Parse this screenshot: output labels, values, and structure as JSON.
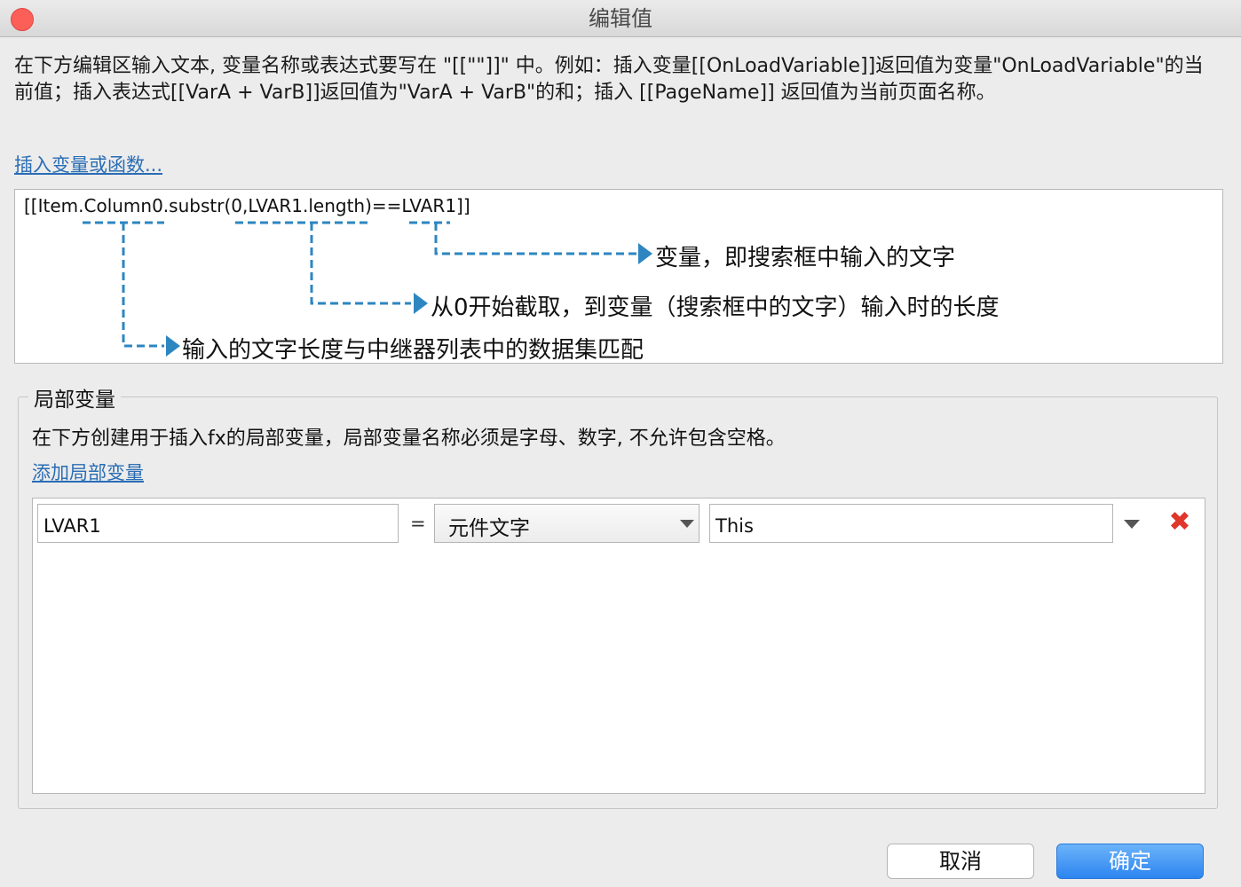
{
  "window": {
    "title": "编辑值"
  },
  "description": "在下方编辑区输入文本, 变量名称或表达式要写在 \"[[\"\"]]\" 中。例如：插入变量[[OnLoadVariable]]返回值为变量\"OnLoadVariable\"的当前值；插入表达式[[VarA + VarB]]返回值为\"VarA + VarB\"的和；插入 [[PageName]] 返回值为当前页面名称。",
  "insert_link": "插入变量或函数...",
  "editor": {
    "expression": "[[Item.Column0.substr(0,LVAR1.length)==LVAR1]]",
    "annotations": [
      "变量，即搜索框中输入的文字",
      "从0开始截取，到变量（搜索框中的文字）输入时的长度",
      "输入的文字长度与中继器列表中的数据集匹配"
    ],
    "annotation_color": "#2e86c1"
  },
  "local_vars": {
    "group_title": "局部变量",
    "description": "在下方创建用于插入fx的局部变量，局部变量名称必须是字母、数字, 不允许包含空格。",
    "add_link": "添加局部变量",
    "rows": [
      {
        "name": "LVAR1",
        "equals": "=",
        "type": "元件文字",
        "value": "This"
      }
    ]
  },
  "buttons": {
    "cancel": "取消",
    "ok": "确定"
  },
  "colors": {
    "link": "#2a6db5",
    "close_dot": "#fc5f57",
    "delete": "#e0362c",
    "primary": "#2c85f0"
  }
}
